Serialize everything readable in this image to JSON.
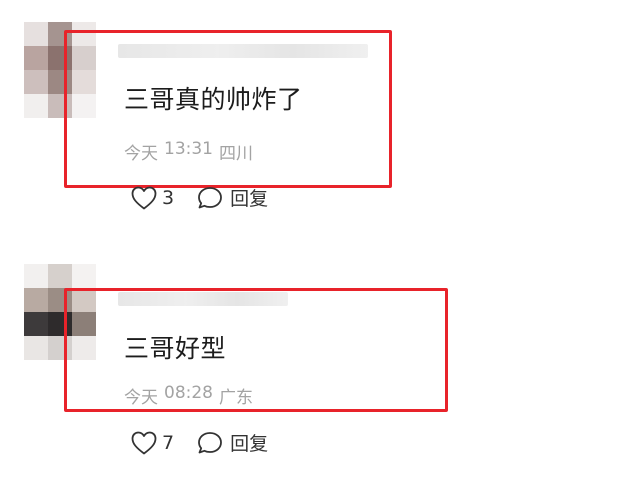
{
  "comments": [
    {
      "text": "三哥真的帅炸了",
      "date": "今天",
      "time": "13:31",
      "location": "四川",
      "likes": "3",
      "reply_label": "回复",
      "avatar_colors": [
        "#e6e0df",
        "#a59490",
        "#ede9e8",
        "#b9a4a0",
        "#8b726e",
        "#d7cfcd",
        "#cdbfbd",
        "#9c8883",
        "#e4dcda",
        "#f1efee",
        "#c9bcba",
        "#f4f2f2"
      ]
    },
    {
      "text": "三哥好型",
      "date": "今天",
      "time": "08:28",
      "location": "广东",
      "likes": "7",
      "reply_label": "回复",
      "avatar_colors": [
        "#f2f0ef",
        "#d6d0cc",
        "#f4f2f1",
        "#b8aaa2",
        "#9b8d85",
        "#d3c9c3",
        "#3d3a3b",
        "#2e2b2c",
        "#8c7f78",
        "#e9e6e4",
        "#d4d0ce",
        "#eeebea"
      ]
    }
  ],
  "colors": {
    "highlight": "#e8232a",
    "meta_text": "#a3a3a3",
    "comment_text": "#1c1c1c"
  },
  "icons": {
    "like": "heart-outline-icon",
    "reply": "speech-bubble-icon"
  }
}
